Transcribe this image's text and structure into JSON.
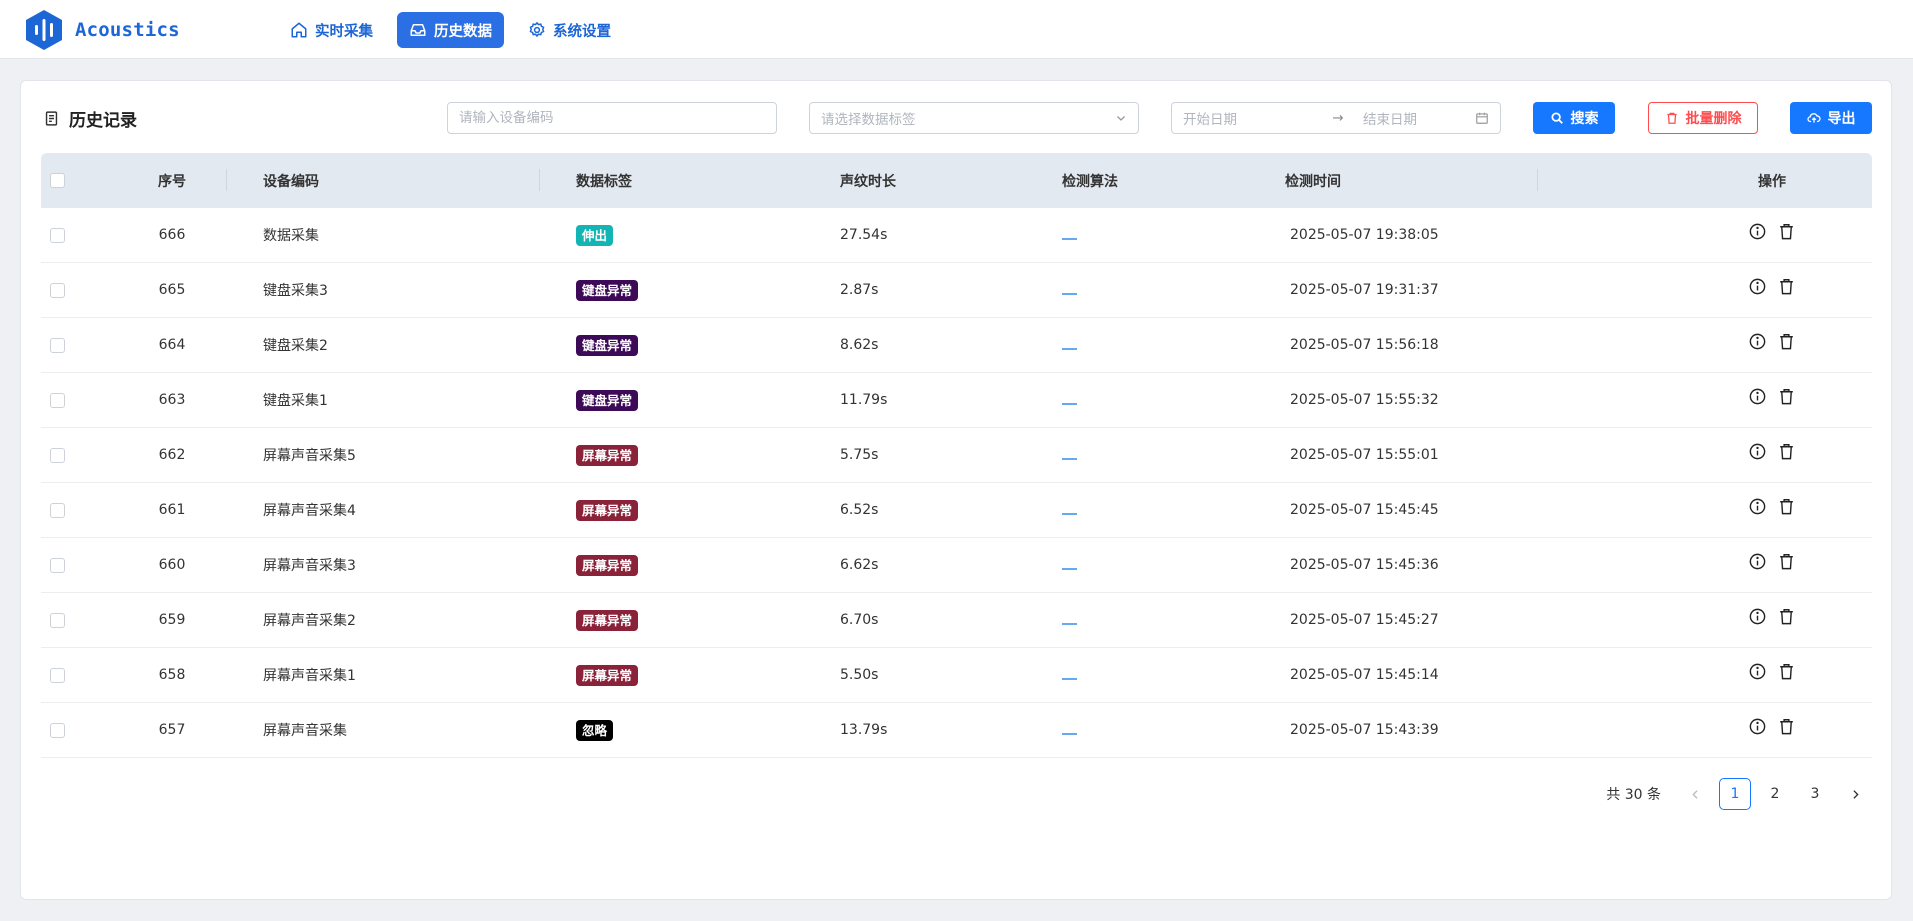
{
  "app": {
    "name": "Acoustics",
    "brand_color": "#1d66d6"
  },
  "nav": [
    {
      "label": "实时采集",
      "icon": "home-icon",
      "active": false
    },
    {
      "label": "历史数据",
      "icon": "inbox-icon",
      "active": true
    },
    {
      "label": "系统设置",
      "icon": "gear-icon",
      "active": false
    }
  ],
  "panel": {
    "title": "历史记录",
    "filters": {
      "device_placeholder": "请输入设备编码",
      "tag_placeholder": "请选择数据标签",
      "start_placeholder": "开始日期",
      "end_placeholder": "结束日期"
    },
    "buttons": {
      "search": "搜索",
      "batch_delete": "批量删除",
      "export": "导出"
    }
  },
  "table": {
    "columns": [
      "序号",
      "设备编码",
      "数据标签",
      "声纹时长",
      "检测算法",
      "检测时间",
      "操作"
    ],
    "rows": [
      {
        "seq": "666",
        "device": "数据采集",
        "tag": "伸出",
        "tag_color": "#13b4b4",
        "duration": "27.54s",
        "time": "2025-05-07 19:38:05"
      },
      {
        "seq": "665",
        "device": "键盘采集3",
        "tag": "键盘异常",
        "tag_color": "#3c0a57",
        "duration": "2.87s",
        "time": "2025-05-07 19:31:37"
      },
      {
        "seq": "664",
        "device": "键盘采集2",
        "tag": "键盘异常",
        "tag_color": "#3c0a57",
        "duration": "8.62s",
        "time": "2025-05-07 15:56:18"
      },
      {
        "seq": "663",
        "device": "键盘采集1",
        "tag": "键盘异常",
        "tag_color": "#3c0a57",
        "duration": "11.79s",
        "time": "2025-05-07 15:55:32"
      },
      {
        "seq": "662",
        "device": "屏幕声音采集5",
        "tag": "屏幕异常",
        "tag_color": "#8a2239",
        "duration": "5.75s",
        "time": "2025-05-07 15:55:01"
      },
      {
        "seq": "661",
        "device": "屏幕声音采集4",
        "tag": "屏幕异常",
        "tag_color": "#8a2239",
        "duration": "6.52s",
        "time": "2025-05-07 15:45:45"
      },
      {
        "seq": "660",
        "device": "屏幕声音采集3",
        "tag": "屏幕异常",
        "tag_color": "#8a2239",
        "duration": "6.62s",
        "time": "2025-05-07 15:45:36"
      },
      {
        "seq": "659",
        "device": "屏幕声音采集2",
        "tag": "屏幕异常",
        "tag_color": "#8a2239",
        "duration": "6.70s",
        "time": "2025-05-07 15:45:27"
      },
      {
        "seq": "658",
        "device": "屏幕声音采集1",
        "tag": "屏幕异常",
        "tag_color": "#8a2239",
        "duration": "5.50s",
        "time": "2025-05-07 15:45:14"
      },
      {
        "seq": "657",
        "device": "屏幕声音采集",
        "tag": "忽略",
        "tag_color": "#000000",
        "duration": "13.79s",
        "time": "2025-05-07 15:43:39"
      }
    ]
  },
  "pagination": {
    "total_text": "共 30 条",
    "pages": [
      "1",
      "2",
      "3"
    ],
    "current": "1"
  }
}
